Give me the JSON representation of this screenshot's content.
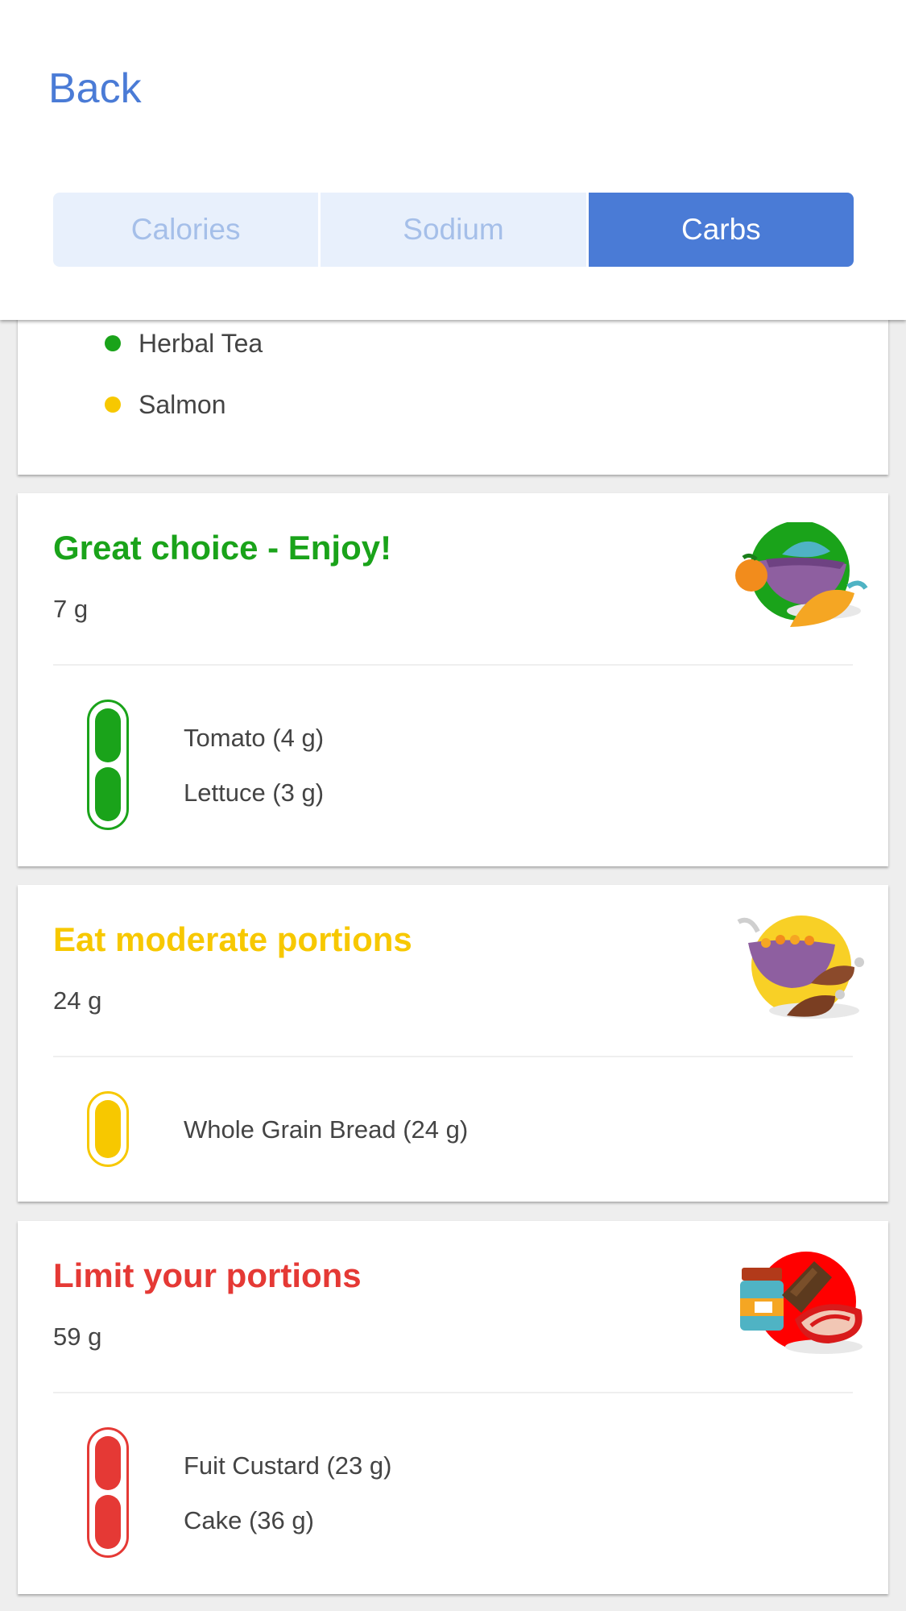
{
  "nav": {
    "back_label": "Back"
  },
  "tabs": [
    {
      "label": "Calories"
    },
    {
      "label": "Sodium"
    },
    {
      "label": "Carbs"
    }
  ],
  "top_list": {
    "items": [
      {
        "label": "Herbal Tea",
        "color": "#1aa31a"
      },
      {
        "label": "Salmon",
        "color": "#f7c800"
      }
    ]
  },
  "great": {
    "title": "Great choice - Enjoy!",
    "amount": "7 g",
    "color": "#1aa31a",
    "items": [
      "Tomato (4 g)",
      "Lettuce (3 g)"
    ]
  },
  "moderate": {
    "title": "Eat moderate portions",
    "amount": "24 g",
    "color": "#f7c800",
    "items": [
      "Whole Grain Bread (24 g)"
    ]
  },
  "limit": {
    "title": "Limit your portions",
    "amount": "59 g",
    "color": "#e53935",
    "items": [
      "Fuit Custard (23 g)",
      "Cake (36 g)"
    ]
  }
}
